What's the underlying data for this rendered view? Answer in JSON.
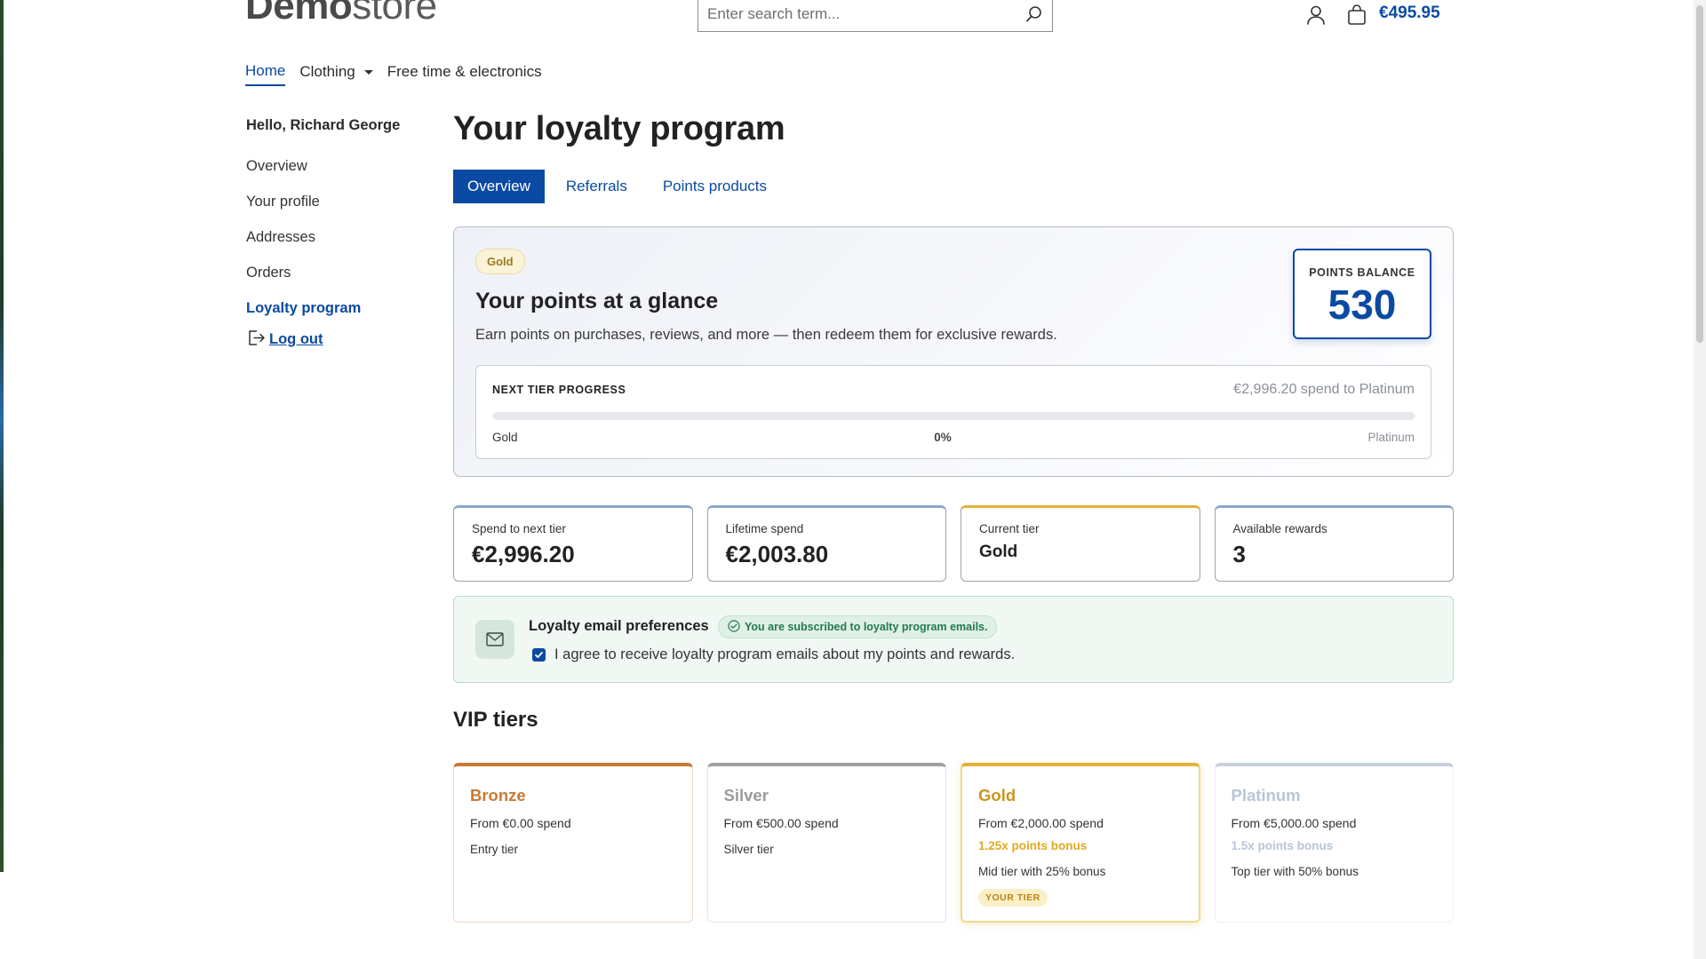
{
  "header": {
    "logo_bold": "Demo",
    "logo_light": "store",
    "search_placeholder": "Enter search term...",
    "cart_total": "€495.95",
    "icons": {
      "search": "search-icon",
      "account": "account-icon",
      "cart": "cart-icon"
    }
  },
  "mainnav": {
    "items": [
      {
        "label": "Home",
        "active": true
      },
      {
        "label": "Clothing",
        "has_dropdown": true
      },
      {
        "label": "Free time & electronics"
      }
    ]
  },
  "sidebar": {
    "greeting": "Hello, Richard George",
    "items": [
      {
        "label": "Overview"
      },
      {
        "label": "Your profile"
      },
      {
        "label": "Addresses"
      },
      {
        "label": "Orders"
      },
      {
        "label": "Loyalty program",
        "active": true
      }
    ],
    "logout": "Log out"
  },
  "main": {
    "title": "Your loyalty program",
    "tabs": [
      {
        "label": "Overview",
        "active": true
      },
      {
        "label": "Referrals"
      },
      {
        "label": "Points products"
      }
    ],
    "glance": {
      "tier_badge": "Gold",
      "heading": "Your points at a glance",
      "lead": "Earn points on purchases, reviews, and more — then redeem them for exclusive rewards.",
      "balance_label": "POINTS BALANCE",
      "balance_value": "530",
      "progress": {
        "title": "NEXT TIER PROGRESS",
        "note": "€2,996.20 spend to Platinum",
        "from": "Gold",
        "percent_label": "0%",
        "percent": 0,
        "to": "Platinum"
      }
    },
    "stats": [
      {
        "label": "Spend to next tier",
        "value": "€2,996.20"
      },
      {
        "label": "Lifetime spend",
        "value": "€2,003.80"
      },
      {
        "label": "Current tier",
        "value": "Gold"
      },
      {
        "label": "Available rewards",
        "value": "3"
      }
    ],
    "email_pref": {
      "title": "Loyalty email preferences",
      "status": "You are subscribed to loyalty program emails.",
      "consent": "I agree to receive loyalty program emails about my points and rewards.",
      "checked": true
    },
    "vip": {
      "title": "VIP tiers",
      "tiers": [
        {
          "name": "Bronze",
          "from": "From €0.00 spend",
          "bonus": "",
          "desc": "Entry tier",
          "badge": ""
        },
        {
          "name": "Silver",
          "from": "From €500.00 spend",
          "bonus": "",
          "desc": "Silver tier",
          "badge": ""
        },
        {
          "name": "Gold",
          "from": "From €2,000.00 spend",
          "bonus": "1.25x points bonus",
          "desc": "Mid tier with 25% bonus",
          "badge": "YOUR TIER"
        },
        {
          "name": "Platinum",
          "from": "From €5,000.00 spend",
          "bonus": "1.5x points bonus",
          "desc": "Top tier with 50% bonus",
          "badge": ""
        }
      ]
    }
  },
  "colors": {
    "primary": "#0b4aa2",
    "bronze": "#c97934",
    "silver": "#9a9a9a",
    "gold": "#e2b13c",
    "platinum": "#c5d0e0",
    "success": "#227a4f"
  }
}
